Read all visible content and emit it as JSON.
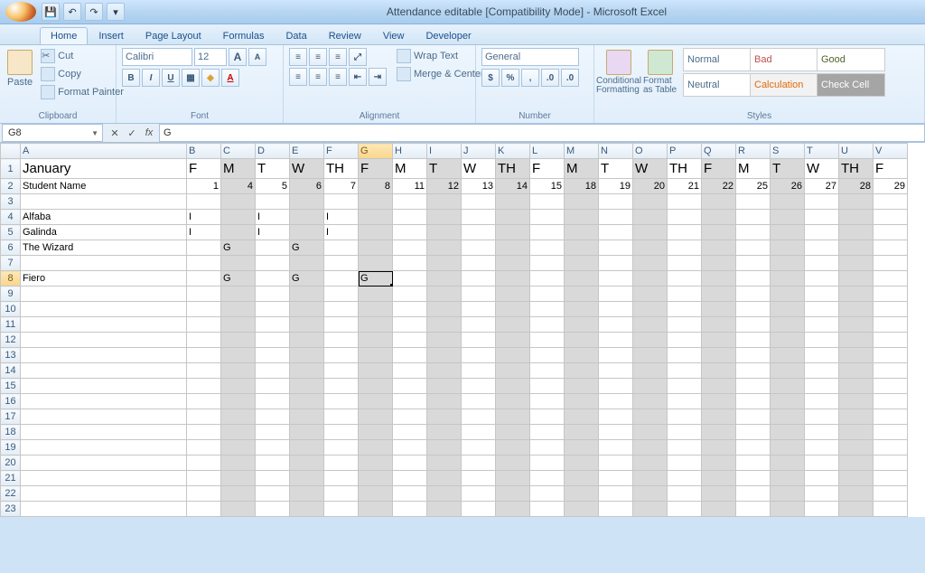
{
  "app_title": "Attendance editable  [Compatibility Mode] - Microsoft Excel",
  "tabs": [
    "Home",
    "Insert",
    "Page Layout",
    "Formulas",
    "Data",
    "Review",
    "View",
    "Developer"
  ],
  "active_tab": 0,
  "clipboard": {
    "paste": "Paste",
    "cut": "Cut",
    "copy": "Copy",
    "fmt": "Format Painter",
    "label": "Clipboard"
  },
  "font": {
    "name": "Calibri",
    "size": "12",
    "label": "Font",
    "grow": "A",
    "shrink": "A",
    "B": "B",
    "I": "I",
    "U": "U"
  },
  "alignment": {
    "wrap": "Wrap Text",
    "merge": "Merge & Center",
    "label": "Alignment"
  },
  "number": {
    "format": "General",
    "label": "Number",
    "cur": "$",
    "pct": "%",
    "comma": ","
  },
  "styles": {
    "cond": "Conditional\nFormatting",
    "fmt_table": "Format as\nTable",
    "label": "Styles",
    "normal": "Normal",
    "bad": "Bad",
    "good": "Good",
    "neutral": "Neutral",
    "calc": "Calculation",
    "check": "Check Cell"
  },
  "namebox": "G8",
  "formula": "G",
  "columns": [
    "A",
    "B",
    "C",
    "D",
    "E",
    "F",
    "G",
    "H",
    "I",
    "J",
    "K",
    "L",
    "M",
    "N",
    "O",
    "P",
    "Q",
    "R",
    "S",
    "T",
    "U",
    "V"
  ],
  "shaded_cols": [
    "C",
    "E",
    "G",
    "I",
    "K",
    "M",
    "O",
    "Q",
    "S",
    "U"
  ],
  "active_cell": {
    "col": "G",
    "row": 8
  },
  "rows": [
    {
      "n": 1,
      "class": "r1",
      "cells": {
        "A": "January",
        "B": "F",
        "C": "M",
        "D": "T",
        "E": "W",
        "F": "TH",
        "G": "F",
        "H": "M",
        "I": "T",
        "J": "W",
        "K": "TH",
        "L": "F",
        "M": "M",
        "N": "T",
        "O": "W",
        "P": "TH",
        "Q": "F",
        "R": "M",
        "S": "T",
        "T": "W",
        "U": "TH",
        "V": "F"
      }
    },
    {
      "n": 2,
      "class": "r2",
      "cells": {
        "A": "Student Name",
        "B": "1",
        "C": "4",
        "D": "5",
        "E": "6",
        "F": "7",
        "G": "8",
        "H": "11",
        "I": "12",
        "J": "13",
        "K": "14",
        "L": "15",
        "M": "18",
        "N": "19",
        "O": "20",
        "P": "21",
        "Q": "22",
        "R": "25",
        "S": "26",
        "T": "27",
        "U": "28",
        "V": "29"
      }
    },
    {
      "n": 3,
      "cells": {}
    },
    {
      "n": 4,
      "cells": {
        "A": "Alfaba",
        "B": "I",
        "D": "I",
        "F": "I"
      }
    },
    {
      "n": 5,
      "cells": {
        "A": "Galinda",
        "B": "I",
        "D": "I",
        "F": "I"
      }
    },
    {
      "n": 6,
      "cells": {
        "A": "The Wizard",
        "C": "G",
        "E": "G"
      }
    },
    {
      "n": 7,
      "cells": {}
    },
    {
      "n": 8,
      "cells": {
        "A": "Fiero",
        "C": "G",
        "E": "G",
        "G": "G"
      }
    },
    {
      "n": 9,
      "cells": {}
    },
    {
      "n": 10,
      "cells": {}
    },
    {
      "n": 11,
      "cells": {}
    },
    {
      "n": 12,
      "cells": {}
    },
    {
      "n": 13,
      "cells": {}
    },
    {
      "n": 14,
      "cells": {}
    },
    {
      "n": 15,
      "cells": {}
    },
    {
      "n": 16,
      "cells": {}
    },
    {
      "n": 17,
      "cells": {}
    },
    {
      "n": 18,
      "cells": {}
    },
    {
      "n": 19,
      "cells": {}
    },
    {
      "n": 20,
      "cells": {}
    },
    {
      "n": 21,
      "cells": {}
    },
    {
      "n": 22,
      "cells": {}
    },
    {
      "n": 23,
      "cells": {}
    }
  ]
}
